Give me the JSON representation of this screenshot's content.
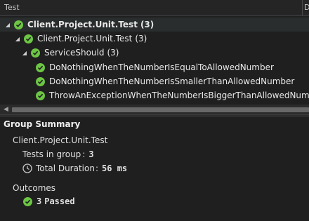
{
  "header": {
    "column_test": "Test",
    "column_d": "D"
  },
  "tree": [
    {
      "label": "Client.Project.Unit.Test",
      "count": "(3)",
      "expanded": true,
      "status": "passed"
    },
    {
      "label": "Client.Project.Unit.Test",
      "count": "(3)",
      "expanded": true,
      "status": "passed"
    },
    {
      "label": "ServiceShould",
      "count": "(3)",
      "expanded": true,
      "status": "passed"
    },
    {
      "label": "DoNothingWhenTheNumberIsEqualToAllowedNumber",
      "status": "passed"
    },
    {
      "label": "DoNothingWhenTheNumberIsSmallerThanAllowedNumber",
      "status": "passed"
    },
    {
      "label": "ThrowAnExceptionWhenTheNumberIsBiggerThanAllowedNumber",
      "status": "passed"
    }
  ],
  "summary": {
    "title": "Group Summary",
    "group_name": "Client.Project.Unit.Test",
    "tests_in_group_label": "Tests in group",
    "tests_in_group_sep": ":",
    "tests_in_group_value": "3",
    "duration_label": "Total Duration",
    "duration_sep": ":",
    "duration_value": "56 ms",
    "outcomes_label": "Outcomes",
    "passed_count": "3",
    "passed_label": "Passed"
  },
  "colors": {
    "pass": "#6cc644",
    "background": "#1f1f1f"
  },
  "icons": {
    "pass": "check-circle-icon",
    "duration": "clock-icon",
    "expand": "caret-down-icon"
  }
}
